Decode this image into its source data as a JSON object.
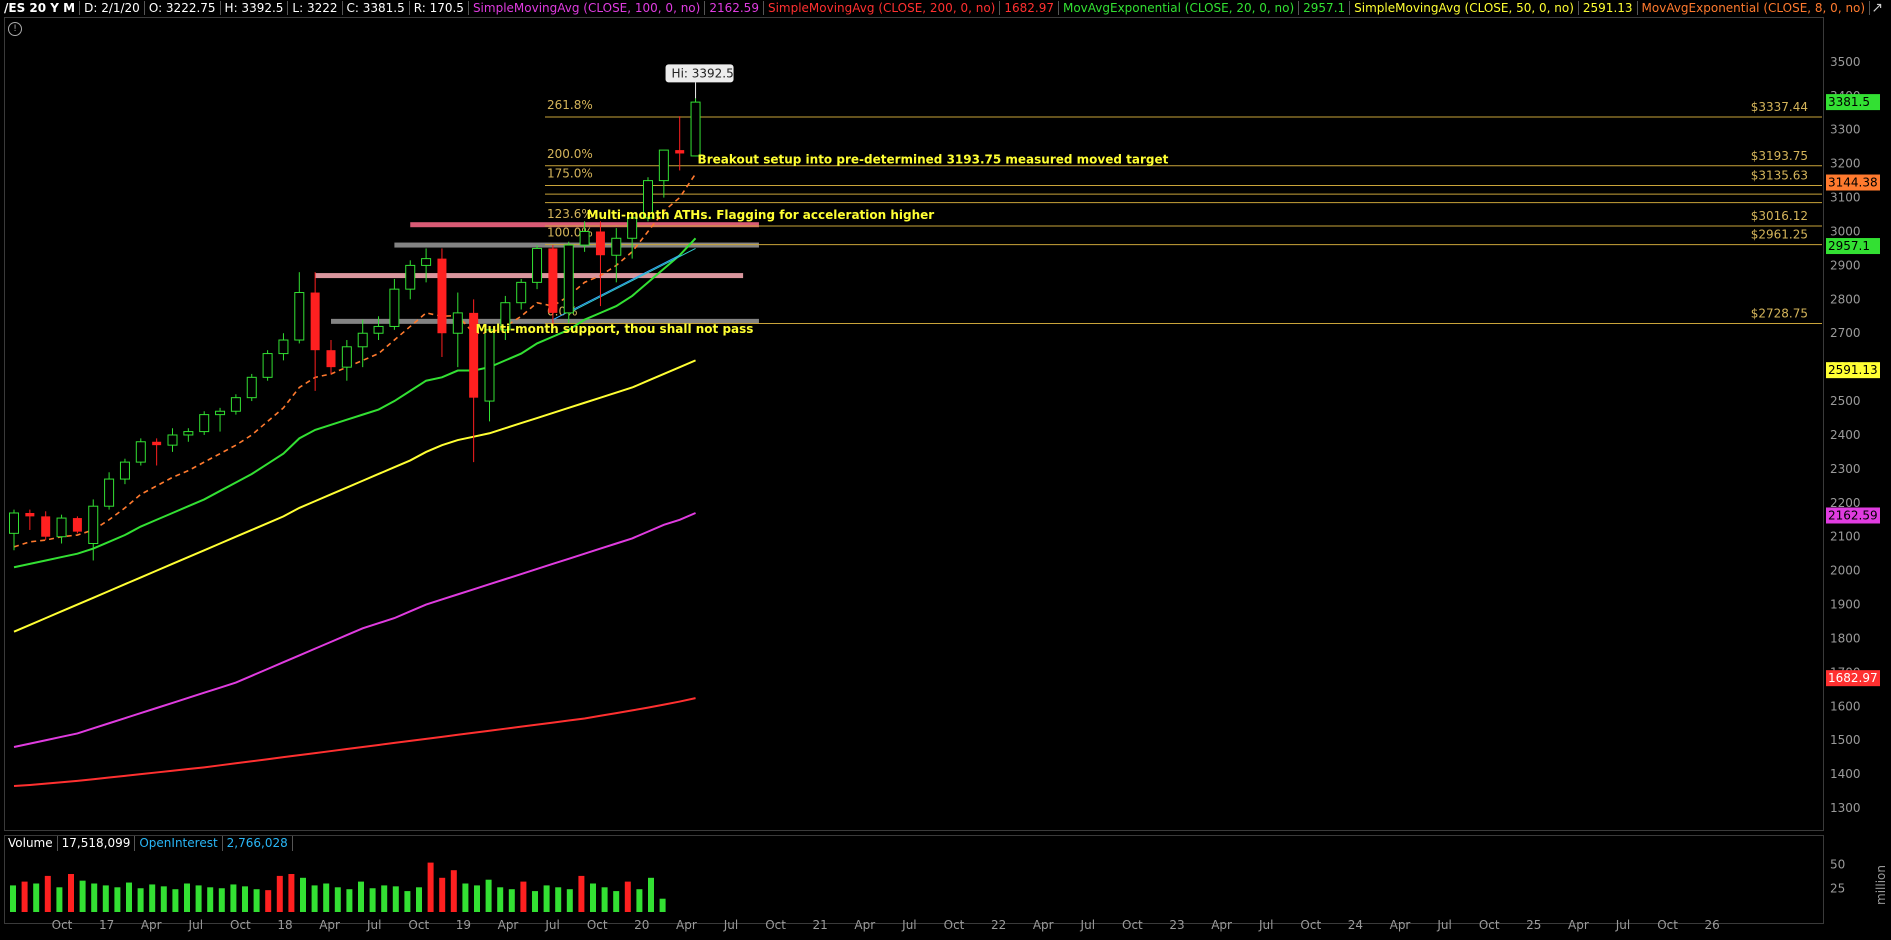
{
  "header": {
    "symbol": "/ES 20 Y M",
    "date": "D: 2/1/20",
    "open": "O: 3222.75",
    "high": "H: 3392.5",
    "low": "L: 3222",
    "close": "C: 3381.5",
    "range": "R: 170.5",
    "studies": [
      {
        "label": "SimpleMovingAvg (CLOSE, 100, 0, no)",
        "value": "2162.59",
        "color": "#e03ce0"
      },
      {
        "label": "SimpleMovingAvg (CLOSE, 200, 0, no)",
        "value": "1682.97",
        "color": "#ff3030"
      },
      {
        "label": "MovAvgExponential (CLOSE, 20, 0, no)",
        "value": "2957.1",
        "color": "#33e033"
      },
      {
        "label": "SimpleMovingAvg (CLOSE, 50, 0, no)",
        "value": "2591.13",
        "color": "#ffff33"
      },
      {
        "label": "MovAvgExponential (CLOSE, 8, 0, no)",
        "value": "",
        "color": "#ff7a2e"
      }
    ]
  },
  "chart_data": {
    "type": "candlestick",
    "title": "/ES 20 Y M",
    "price_axis": {
      "ylim": [
        1250,
        3600
      ],
      "ticks": [
        1300,
        1400,
        1500,
        1600,
        1700,
        1800,
        1900,
        2000,
        2100,
        2200,
        2300,
        2400,
        2500,
        2600,
        2700,
        2800,
        2900,
        3000,
        3100,
        3200,
        3300,
        3400,
        3500
      ]
    },
    "x_axis": {
      "labels": [
        "Oct",
        "17",
        "Apr",
        "Jul",
        "Oct",
        "18",
        "Apr",
        "Jul",
        "Oct",
        "19",
        "Apr",
        "Jul",
        "Oct",
        "20",
        "Apr",
        "Jul",
        "Oct",
        "21",
        "Apr",
        "Jul",
        "Oct",
        "22",
        "Apr",
        "Jul",
        "Oct",
        "23",
        "Apr",
        "Jul",
        "Oct",
        "24",
        "Apr",
        "Jul",
        "Oct",
        "25",
        "Apr",
        "Jul",
        "Oct",
        "26"
      ],
      "start_month": "2016-09"
    },
    "candles": [
      {
        "o": 2110,
        "h": 2180,
        "l": 2060,
        "c": 2170
      },
      {
        "o": 2170,
        "h": 2180,
        "l": 2120,
        "c": 2160
      },
      {
        "o": 2160,
        "h": 2175,
        "l": 2090,
        "c": 2100
      },
      {
        "o": 2100,
        "h": 2165,
        "l": 2080,
        "c": 2155
      },
      {
        "o": 2155,
        "h": 2160,
        "l": 2110,
        "c": 2115
      },
      {
        "o": 2080,
        "h": 2210,
        "l": 2030,
        "c": 2190
      },
      {
        "o": 2190,
        "h": 2290,
        "l": 2180,
        "c": 2270
      },
      {
        "o": 2270,
        "h": 2330,
        "l": 2255,
        "c": 2320
      },
      {
        "o": 2320,
        "h": 2390,
        "l": 2310,
        "c": 2380
      },
      {
        "o": 2380,
        "h": 2390,
        "l": 2310,
        "c": 2370
      },
      {
        "o": 2370,
        "h": 2420,
        "l": 2350,
        "c": 2400
      },
      {
        "o": 2400,
        "h": 2420,
        "l": 2380,
        "c": 2410
      },
      {
        "o": 2410,
        "h": 2470,
        "l": 2400,
        "c": 2460
      },
      {
        "o": 2460,
        "h": 2480,
        "l": 2410,
        "c": 2470
      },
      {
        "o": 2470,
        "h": 2520,
        "l": 2460,
        "c": 2510
      },
      {
        "o": 2510,
        "h": 2580,
        "l": 2500,
        "c": 2570
      },
      {
        "o": 2570,
        "h": 2650,
        "l": 2560,
        "c": 2640
      },
      {
        "o": 2640,
        "h": 2700,
        "l": 2620,
        "c": 2680
      },
      {
        "o": 2680,
        "h": 2880,
        "l": 2670,
        "c": 2820
      },
      {
        "o": 2820,
        "h": 2880,
        "l": 2530,
        "c": 2650
      },
      {
        "o": 2650,
        "h": 2680,
        "l": 2580,
        "c": 2600
      },
      {
        "o": 2600,
        "h": 2680,
        "l": 2560,
        "c": 2660
      },
      {
        "o": 2660,
        "h": 2740,
        "l": 2600,
        "c": 2700
      },
      {
        "o": 2700,
        "h": 2750,
        "l": 2680,
        "c": 2720
      },
      {
        "o": 2720,
        "h": 2860,
        "l": 2710,
        "c": 2830
      },
      {
        "o": 2830,
        "h": 2915,
        "l": 2800,
        "c": 2900
      },
      {
        "o": 2900,
        "h": 2950,
        "l": 2850,
        "c": 2920
      },
      {
        "o": 2920,
        "h": 2950,
        "l": 2630,
        "c": 2700
      },
      {
        "o": 2700,
        "h": 2820,
        "l": 2600,
        "c": 2760
      },
      {
        "o": 2760,
        "h": 2800,
        "l": 2320,
        "c": 2510
      },
      {
        "o": 2500,
        "h": 2720,
        "l": 2440,
        "c": 2710
      },
      {
        "o": 2710,
        "h": 2810,
        "l": 2680,
        "c": 2790
      },
      {
        "o": 2790,
        "h": 2860,
        "l": 2770,
        "c": 2850
      },
      {
        "o": 2850,
        "h": 2960,
        "l": 2830,
        "c": 2950
      },
      {
        "o": 2950,
        "h": 2960,
        "l": 2720,
        "c": 2760
      },
      {
        "o": 2760,
        "h": 2970,
        "l": 2730,
        "c": 2960
      },
      {
        "o": 2960,
        "h": 3030,
        "l": 2940,
        "c": 3000
      },
      {
        "o": 3000,
        "h": 3030,
        "l": 2780,
        "c": 2930
      },
      {
        "o": 2930,
        "h": 3010,
        "l": 2850,
        "c": 2980
      },
      {
        "o": 2980,
        "h": 3050,
        "l": 2920,
        "c": 3040
      },
      {
        "o": 3040,
        "h": 3160,
        "l": 3030,
        "c": 3150
      },
      {
        "o": 3150,
        "h": 3240,
        "l": 3100,
        "c": 3240
      },
      {
        "o": 3240,
        "h": 3340,
        "l": 3180,
        "c": 3230
      },
      {
        "o": 3222.75,
        "h": 3392.5,
        "l": 3222,
        "c": 3381.5
      }
    ],
    "moving_averages": [
      {
        "name": "MovAvgExponential (CLOSE, 8, 0, no)",
        "color": "#ff7a2e",
        "dashed": true,
        "values": [
          2070,
          2085,
          2090,
          2100,
          2105,
          2120,
          2150,
          2185,
          2225,
          2250,
          2275,
          2295,
          2320,
          2345,
          2370,
          2400,
          2440,
          2480,
          2540,
          2570,
          2580,
          2600,
          2620,
          2640,
          2680,
          2720,
          2760,
          2750,
          2752,
          2700,
          2700,
          2720,
          2750,
          2790,
          2780,
          2810,
          2850,
          2870,
          2900,
          2940,
          3000,
          3060,
          3100,
          3170
        ]
      },
      {
        "name": "MovAvgExponential (CLOSE, 20, 0, no)",
        "color": "#33e033",
        "dashed": false,
        "values": [
          2010,
          2020,
          2030,
          2040,
          2050,
          2065,
          2085,
          2105,
          2130,
          2150,
          2170,
          2190,
          2210,
          2235,
          2260,
          2285,
          2315,
          2345,
          2390,
          2415,
          2430,
          2445,
          2460,
          2475,
          2500,
          2530,
          2560,
          2570,
          2590,
          2590,
          2600,
          2620,
          2640,
          2670,
          2690,
          2710,
          2740,
          2760,
          2780,
          2810,
          2850,
          2890,
          2930,
          2980
        ]
      },
      {
        "name": "SimpleMovingAvg (CLOSE, 50, 0, no)",
        "color": "#ffff33",
        "dashed": false,
        "values": [
          1820,
          1840,
          1860,
          1880,
          1900,
          1920,
          1940,
          1960,
          1980,
          2000,
          2020,
          2040,
          2060,
          2080,
          2100,
          2120,
          2140,
          2160,
          2185,
          2205,
          2225,
          2245,
          2265,
          2285,
          2305,
          2325,
          2350,
          2370,
          2385,
          2395,
          2405,
          2420,
          2435,
          2450,
          2465,
          2480,
          2495,
          2510,
          2525,
          2540,
          2560,
          2580,
          2600,
          2620
        ]
      },
      {
        "name": "SimpleMovingAvg (CLOSE, 100, 0, no)",
        "color": "#e03ce0",
        "dashed": false,
        "values": [
          1480,
          1490,
          1500,
          1510,
          1520,
          1535,
          1550,
          1565,
          1580,
          1595,
          1610,
          1625,
          1640,
          1655,
          1670,
          1690,
          1710,
          1730,
          1750,
          1770,
          1790,
          1810,
          1830,
          1845,
          1860,
          1880,
          1900,
          1915,
          1930,
          1945,
          1960,
          1975,
          1990,
          2005,
          2020,
          2035,
          2050,
          2065,
          2080,
          2095,
          2115,
          2135,
          2150,
          2170
        ]
      },
      {
        "name": "SimpleMovingAvg (CLOSE, 200, 0, no)",
        "color": "#ff3030",
        "dashed": false,
        "values": [
          1365,
          1368,
          1372,
          1376,
          1380,
          1385,
          1390,
          1395,
          1400,
          1405,
          1410,
          1415,
          1420,
          1426,
          1432,
          1438,
          1444,
          1450,
          1456,
          1462,
          1468,
          1474,
          1480,
          1486,
          1492,
          1498,
          1504,
          1510,
          1516,
          1522,
          1528,
          1534,
          1540,
          1546,
          1552,
          1558,
          1564,
          1572,
          1580,
          1588,
          1596,
          1605,
          1614,
          1624
        ]
      }
    ],
    "fib_levels": [
      {
        "pct": "261.8%",
        "price": 3337.44,
        "price_label": "$3337.44"
      },
      {
        "pct": "200.0%",
        "price": 3193.75,
        "price_label": "$3193.75"
      },
      {
        "pct": "175.0%",
        "price": 3135.63,
        "price_label": "$3135.63"
      },
      {
        "pct": "123.6%",
        "price": 3016.12,
        "price_label": "$3016.12"
      },
      {
        "pct": "100.0%",
        "price": 2961.25,
        "price_label": "$2961.25"
      },
      {
        "pct": "0.0%",
        "price": 2728.75,
        "price_label": "$2728.75"
      }
    ],
    "extra_fib_lines": [
      3110,
      3085
    ],
    "zones": [
      {
        "price": 3020,
        "color": "#ff6b8a",
        "start": 25,
        "end": 47
      },
      {
        "price": 2870,
        "color": "#ffb0b8",
        "start": 19,
        "end": 46
      },
      {
        "price": 2960,
        "color": "#9a9a9a",
        "start": 24,
        "end": 47
      },
      {
        "price": 2735,
        "color": "#9a9a9a",
        "start": 20,
        "end": 47
      }
    ],
    "annotations": [
      {
        "text": "Breakout setup  into pre-determined 3193.75 measured moved target",
        "price": 3200,
        "x_index": 43
      },
      {
        "text": "Multi-month ATHs. Flagging for acceleration higher",
        "price": 3037,
        "x_index": 36
      },
      {
        "text": "Multi-month support, thou shall not pass",
        "price": 2700,
        "x_index": 29
      }
    ],
    "hi_callout": "Hi: 3392.5",
    "price_tags": [
      {
        "text": "3381.5",
        "price": 3381.5,
        "bg": "#33e033",
        "fg": "#000"
      },
      {
        "text": "3144.38",
        "price": 3144.38,
        "bg": "#ff7a2e",
        "fg": "#000"
      },
      {
        "text": "2957.1",
        "price": 2957.1,
        "bg": "#33e033",
        "fg": "#000"
      },
      {
        "text": "2591.13",
        "price": 2591.13,
        "bg": "#ffff33",
        "fg": "#000"
      },
      {
        "text": "2162.59",
        "price": 2162.59,
        "bg": "#e03ce0",
        "fg": "#000"
      },
      {
        "text": "1682.97",
        "price": 1682.97,
        "bg": "#ff3030",
        "fg": "#fff"
      }
    ],
    "volume": {
      "label": "Volume",
      "value": "17,518,099",
      "oi_label": "OpenInterest",
      "oi_value": "2,766,028",
      "ticks": [
        "50",
        "25"
      ],
      "unit_label": "million",
      "ylim": [
        0,
        60
      ],
      "bars": [
        28,
        32,
        30,
        38,
        26,
        40,
        33,
        30,
        28,
        26,
        31,
        25,
        29,
        27,
        24,
        30,
        28,
        26,
        25,
        29,
        27,
        24,
        23,
        38,
        40,
        36,
        28,
        30,
        26,
        24,
        32,
        25,
        28,
        27,
        22,
        26,
        52,
        36,
        44,
        30,
        28,
        34,
        26,
        24,
        32,
        22,
        28,
        26,
        24,
        38,
        30,
        26,
        22,
        32,
        24,
        36,
        14
      ]
    }
  }
}
